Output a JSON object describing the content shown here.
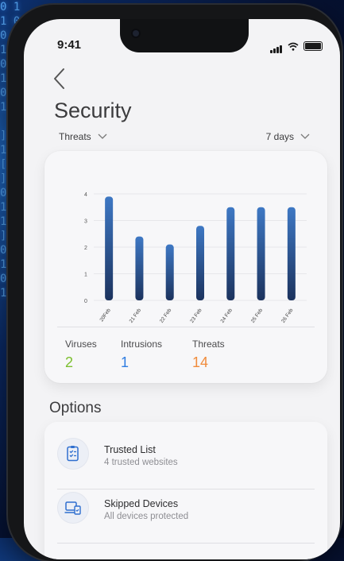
{
  "status_bar": {
    "time": "9:41"
  },
  "header": {
    "title": "Security"
  },
  "filters": {
    "metric": "Threats",
    "range": "7 days"
  },
  "chart_data": {
    "type": "bar",
    "categories": [
      "20Feb",
      "21 Feb",
      "22 Feb",
      "23 Feb",
      "24 Feb",
      "25 Feb",
      "26 Feb"
    ],
    "values": [
      3.9,
      2.4,
      2.1,
      2.8,
      3.5,
      3.5,
      3.5
    ],
    "ylim": [
      0,
      4
    ],
    "yticks": [
      0,
      1,
      2,
      3,
      4
    ],
    "grid": true,
    "bar_color_top": "#3e78c4",
    "bar_color_bottom": "#1c335e"
  },
  "stats": [
    {
      "label": "Viruses",
      "value": "2",
      "color": "#7cbf2f"
    },
    {
      "label": "Intrusions",
      "value": "1",
      "color": "#2f7de1"
    },
    {
      "label": "Threats",
      "value": "14",
      "color": "#f08c3c"
    }
  ],
  "options": {
    "title": "Options",
    "items": [
      {
        "title": "Trusted List",
        "subtitle": "4 trusted websites",
        "icon": "checklist-icon"
      },
      {
        "title": "Skipped Devices",
        "subtitle": "All devices protected",
        "icon": "devices-icon"
      }
    ]
  }
}
